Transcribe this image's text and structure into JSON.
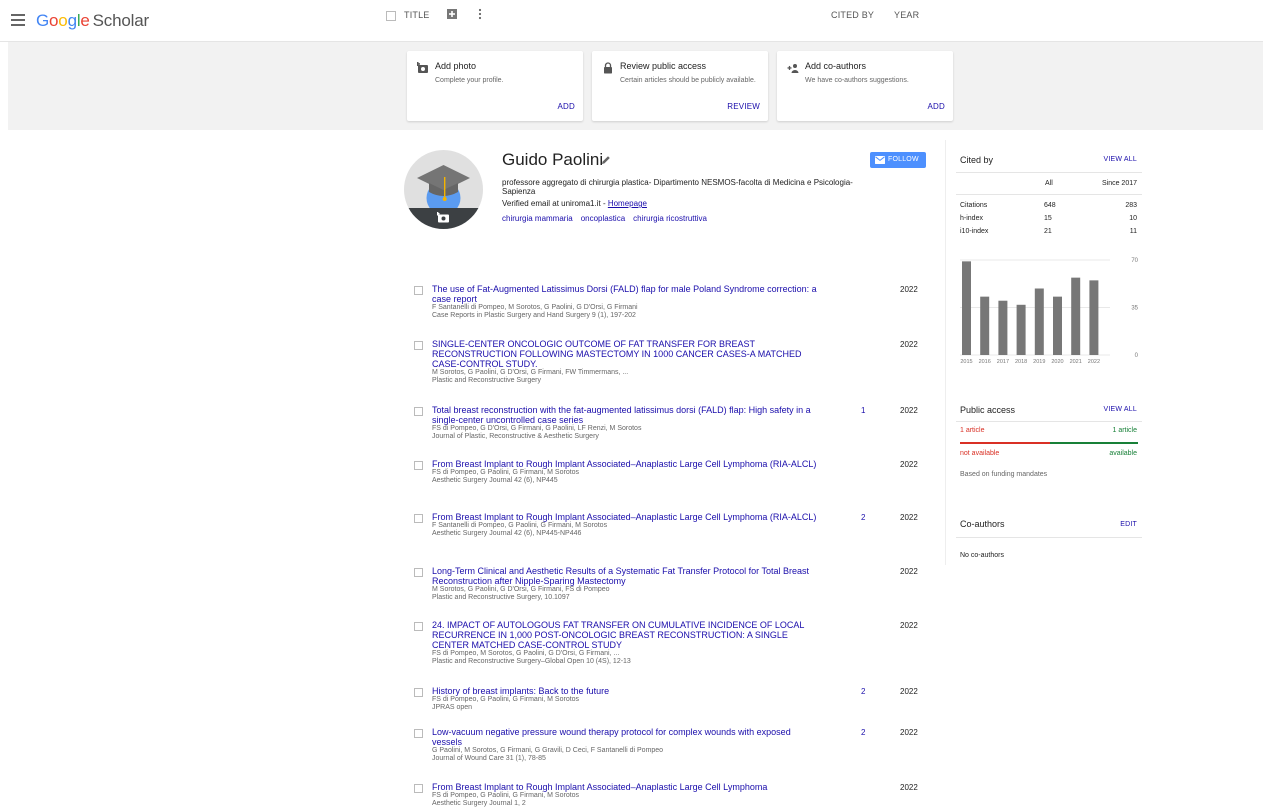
{
  "app": {
    "logo_letters": [
      "G",
      "o",
      "o",
      "g",
      "l",
      "e"
    ],
    "logo_suffix": "Scholar"
  },
  "list_header": {
    "title": "TITLE",
    "cited_by": "CITED BY",
    "year": "YEAR"
  },
  "cards": [
    {
      "icon": "add-photo-icon",
      "title": "Add photo",
      "desc": "Complete your profile.",
      "action": "ADD"
    },
    {
      "icon": "lock-icon",
      "title": "Review public access",
      "desc": "Certain articles should be publicly available.",
      "action": "REVIEW"
    },
    {
      "icon": "add-person-icon",
      "title": "Add co-authors",
      "desc": "We have co-authors suggestions.",
      "action": "ADD"
    }
  ],
  "profile": {
    "name": "Guido Paolini",
    "affiliation": "professore aggregato di chirurgia plastica- Dipartimento NESMOS-facolta di Medicina e Psicologia- Sapienza",
    "email_text": "Verified email at uniroma1.it - ",
    "homepage": "Homepage",
    "interests": [
      "chirurgia mammaria",
      "oncoplastica",
      "chirurgia ricostruttiva"
    ],
    "follow": "FOLLOW"
  },
  "articles": [
    {
      "title": "The use of Fat-Augmented Latissimus Dorsi (FALD) flap for male Poland Syndrome correction: a case report",
      "authors": "F Santanelli di Pompeo, M Sorotos, G Paolini, G D'Orsi, G Firmani",
      "venue": "Case Reports in Plastic Surgery and Hand Surgery 9 (1), 197-202",
      "cited": "",
      "year": "2022"
    },
    {
      "title": "SINGLE-CENTER ONCOLOGIC OUTCOME OF FAT TRANSFER FOR BREAST RECONSTRUCTION FOLLOWING MASTECTOMY IN 1000 CANCER CASES-A MATCHED CASE-CONTROL STUDY.",
      "authors": "M Sorotos, G Paolini, G D'Orsi, G Firmani, FW Timmermans, ...",
      "venue": "Plastic and Reconstructive Surgery",
      "cited": "",
      "year": "2022"
    },
    {
      "title": "Total breast reconstruction with the fat-augmented latissimus dorsi (FALD) flap: High safety in a single-center uncontrolled case series",
      "authors": "FS di Pompeo, G D'Orsi, G Firmani, G Paolini, LF Renzi, M Sorotos",
      "venue": "Journal of Plastic, Reconstructive & Aesthetic Surgery",
      "cited": "1",
      "year": "2022"
    },
    {
      "title": "From Breast Implant to Rough Implant Associated–Anaplastic Large Cell Lymphoma (RIA-ALCL)",
      "authors": "FS di Pompeo, G Paolini, G Firmani, M Sorotos",
      "venue": "Aesthetic Surgery Journal 42 (6), NP445",
      "cited": "",
      "year": "2022"
    },
    {
      "title": "From Breast Implant to Rough Implant Associated–Anaplastic Large Cell Lymphoma (RIA-ALCL)",
      "authors": "F Santanelli di Pompeo, G Paolini, G Firmani, M Sorotos",
      "venue": "Aesthetic Surgery Journal 42 (6), NP445-NP446",
      "cited": "2",
      "year": "2022"
    },
    {
      "title": "Long-Term Clinical and Aesthetic Results of a Systematic Fat Transfer Protocol for Total Breast Reconstruction after Nipple-Sparing Mastectomy",
      "authors": "M Sorotos, G Paolini, G D'Orsi, G Firmani, FS di Pompeo",
      "venue": "Plastic and Reconstructive Surgery, 10.1097",
      "cited": "",
      "year": "2022"
    },
    {
      "title": "24. IMPACT OF AUTOLOGOUS FAT TRANSFER ON CUMULATIVE INCIDENCE OF LOCAL RECURRENCE IN 1,000 POST-ONCOLOGIC BREAST RECONSTRUCTION: A SINGLE CENTER MATCHED CASE-CONTROL STUDY",
      "authors": "FS di Pompeo, M Sorotos, G Paolini, G D'Orsi, G Firmani, ...",
      "venue": "Plastic and Reconstructive Surgery–Global Open 10 (4S), 12-13",
      "cited": "",
      "year": "2022"
    },
    {
      "title": "History of breast implants: Back to the future",
      "authors": "FS di Pompeo, G Paolini, G Firmani, M Sorotos",
      "venue": "JPRAS open",
      "cited": "2",
      "year": "2022"
    },
    {
      "title": "Low-vacuum negative pressure wound therapy protocol for complex wounds with exposed vessels",
      "authors": "G Paolini, M Sorotos, G Firmani, G Gravili, D Ceci, F Santanelli di Pompeo",
      "venue": "Journal of Wound Care 31 (1), 78-85",
      "cited": "2",
      "year": "2022"
    },
    {
      "title": "From Breast Implant to Rough Implant Associated–Anaplastic Large Cell Lymphoma",
      "authors": "FS di Pompeo, G Paolini, G Firmani, M Sorotos",
      "venue": "Aesthetic Surgery Journal 1, 2",
      "cited": "",
      "year": "2022"
    }
  ],
  "cited_by": {
    "title": "Cited by",
    "view_all": "VIEW ALL",
    "col_all": "All",
    "col_since": "Since 2017",
    "metrics": [
      {
        "label": "Citations",
        "all": "648",
        "since": "283"
      },
      {
        "label": "h-index",
        "all": "15",
        "since": "10"
      },
      {
        "label": "i10-index",
        "all": "21",
        "since": "11"
      }
    ]
  },
  "chart_data": {
    "type": "bar",
    "categories": [
      "2015",
      "2016",
      "2017",
      "2018",
      "2019",
      "2020",
      "2021",
      "2022"
    ],
    "values": [
      69,
      43,
      40,
      37,
      49,
      43,
      57,
      55
    ],
    "ylim": [
      0,
      70
    ],
    "yticks": [
      "70",
      "35",
      "0"
    ],
    "color": "#777777"
  },
  "public_access": {
    "title": "Public access",
    "view_all": "VIEW ALL",
    "left_count": "1 article",
    "right_count": "1 article",
    "left_label": "not available",
    "right_label": "available",
    "note": "Based on funding mandates",
    "left_color": "#d93025",
    "right_color": "#188038"
  },
  "coauthors": {
    "title": "Co-authors",
    "edit": "EDIT",
    "empty": "No co-authors"
  }
}
